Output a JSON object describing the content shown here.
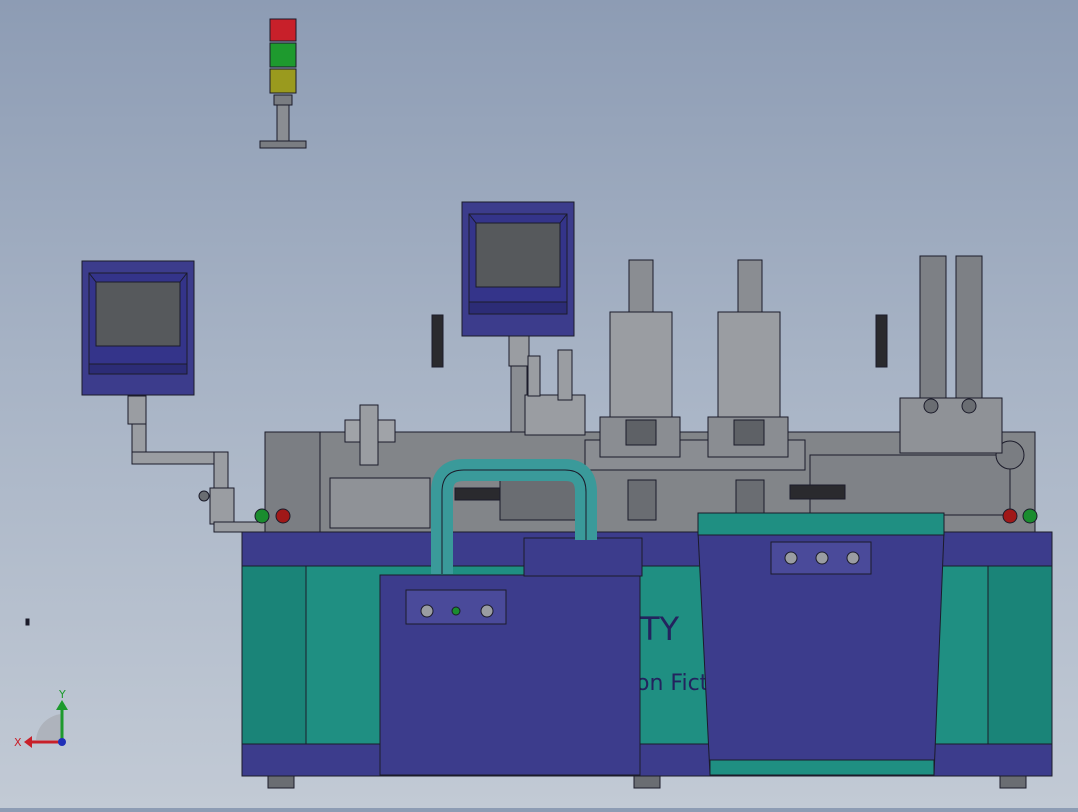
{
  "view": {
    "kind": "3D CAD assembly viewport",
    "background_top": "#8d9cb4",
    "background_bottom": "#c2cad5"
  },
  "colors": {
    "frame": "#3c3c8c",
    "frame_dark": "#23235e",
    "panel_teal": "#1f8f82",
    "pipe_teal": "#3a9a9a",
    "steel": "#7a7d82",
    "steel_light": "#9a9da2",
    "screen": "#56595c",
    "lamp_red": "#c8202a",
    "lamp_green": "#1e9a2e",
    "lamp_yellow": "#9a9a1e",
    "button_green": "#1a8c2e",
    "button_red": "#a01818"
  },
  "machine": {
    "side_text_top": "TY",
    "side_text_bottom": "on Fictio"
  },
  "triad": {
    "x_label": "X",
    "y_label": "Y"
  }
}
